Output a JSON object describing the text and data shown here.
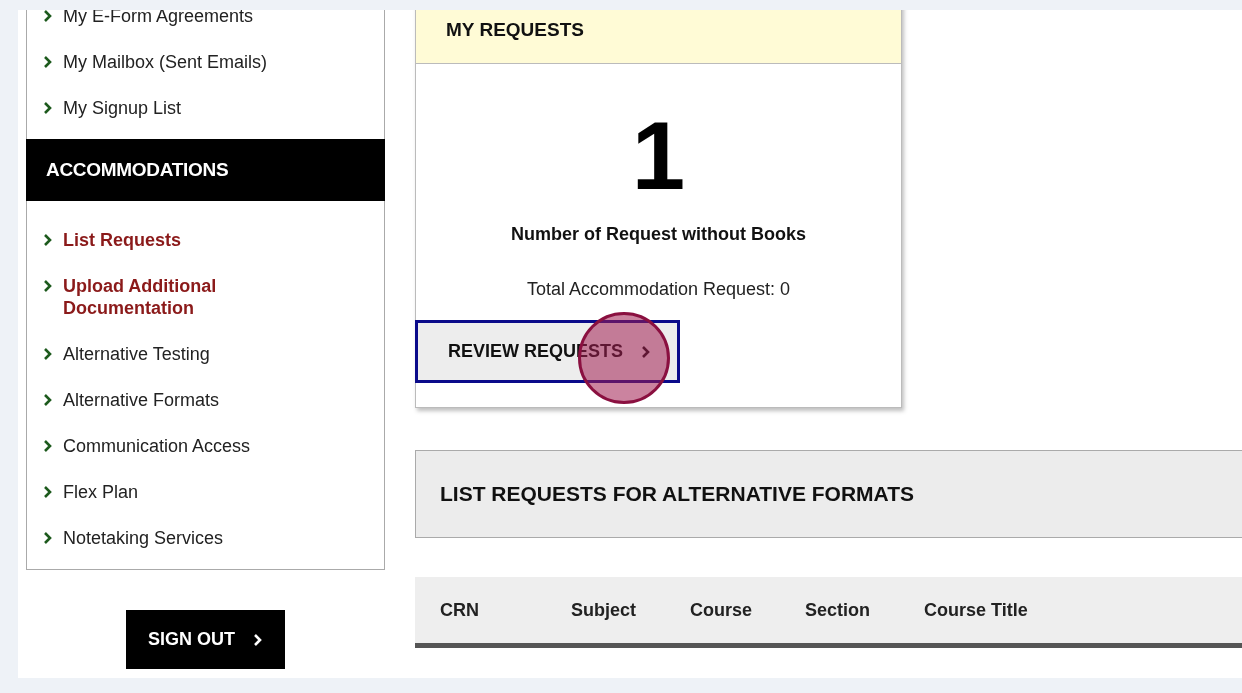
{
  "sidebar": {
    "items_top": [
      {
        "label": "My E-Form Agreements",
        "selected": false
      },
      {
        "label": "My Mailbox (Sent Emails)",
        "selected": false
      },
      {
        "label": "My Signup List",
        "selected": false
      }
    ],
    "section_title": "ACCOMMODATIONS",
    "items": [
      {
        "label": "List Requests",
        "selected": true
      },
      {
        "label": "Upload Additional Documentation",
        "selected": true
      },
      {
        "label": "Alternative Testing",
        "selected": false
      },
      {
        "label": "Alternative Formats",
        "selected": false
      },
      {
        "label": "Communication Access",
        "selected": false
      },
      {
        "label": "Flex Plan",
        "selected": false
      },
      {
        "label": "Notetaking Services",
        "selected": false
      }
    ],
    "sign_out": "SIGN OUT"
  },
  "card": {
    "title": "MY REQUESTS",
    "count": "1",
    "caption": "Number of Request without Books",
    "total": "Total Accommodation Request: 0",
    "button": "REVIEW REQUESTS",
    "highlighted": true,
    "click_marker": true
  },
  "list_panel": {
    "title": "LIST REQUESTS FOR ALTERNATIVE FORMATS"
  },
  "table": {
    "columns": [
      "CRN",
      "Subject",
      "Course",
      "Section",
      "Course Title"
    ]
  }
}
